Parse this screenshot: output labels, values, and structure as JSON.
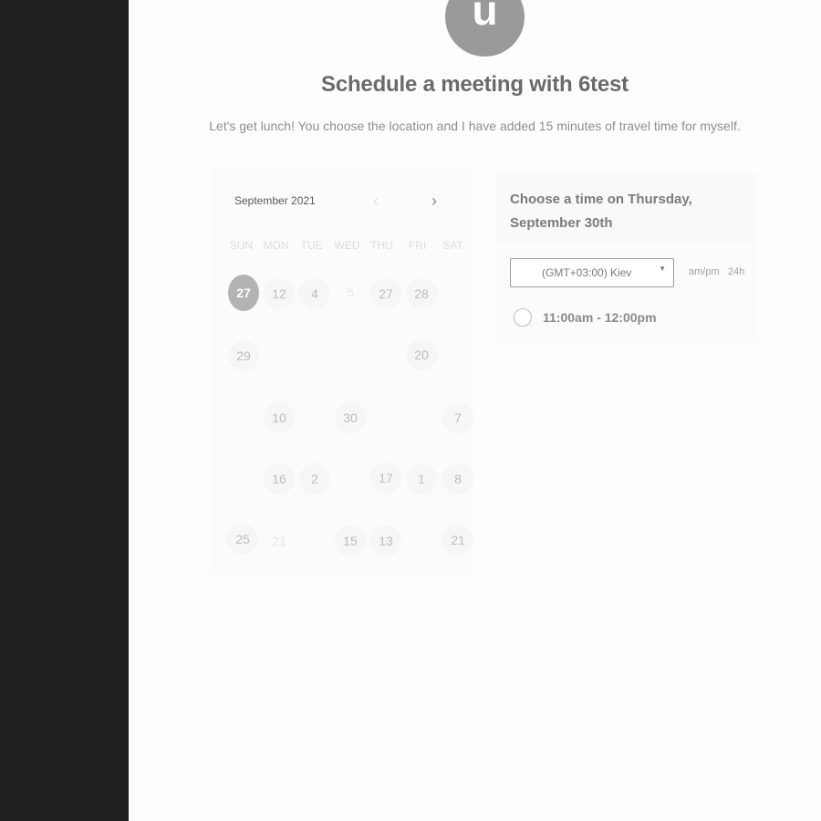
{
  "avatar": {
    "initial": "u"
  },
  "header": {
    "title": "Schedule a meeting with 6test",
    "subtitle": "Let's get lunch! You choose the location and I have added 15 minutes of travel time for myself."
  },
  "calendar": {
    "month": "September 2021",
    "prev_icon": "chevron-left-icon",
    "next_icon": "chevron-right-icon",
    "weekdays": [
      "SUN",
      "MON",
      "TUE",
      "WED",
      "THU",
      "FRI",
      "SAT"
    ],
    "selected_day": "27",
    "days": {
      "r1": [
        "27",
        "12",
        "4",
        "5",
        "27",
        "28"
      ],
      "r2": [
        "29",
        "20"
      ],
      "r3": [
        "10",
        "30",
        "7"
      ],
      "r4": [
        "16",
        "2",
        "17",
        "1",
        "8"
      ],
      "r5": [
        "25",
        "21",
        "15",
        "13",
        "21"
      ]
    }
  },
  "time_panel": {
    "heading": "Choose a time on Thursday, September 30th",
    "timezone": "(GMT+03:00) Kiev",
    "format_ampm": "am/pm",
    "format_24h": "24h",
    "slots": [
      "11:00am - 12:00pm"
    ]
  },
  "colors": {
    "sidebar": "#202020",
    "background": "#fdfdfd",
    "avatar": "#9a9a9a",
    "selected_day": "#b3b3b3"
  }
}
